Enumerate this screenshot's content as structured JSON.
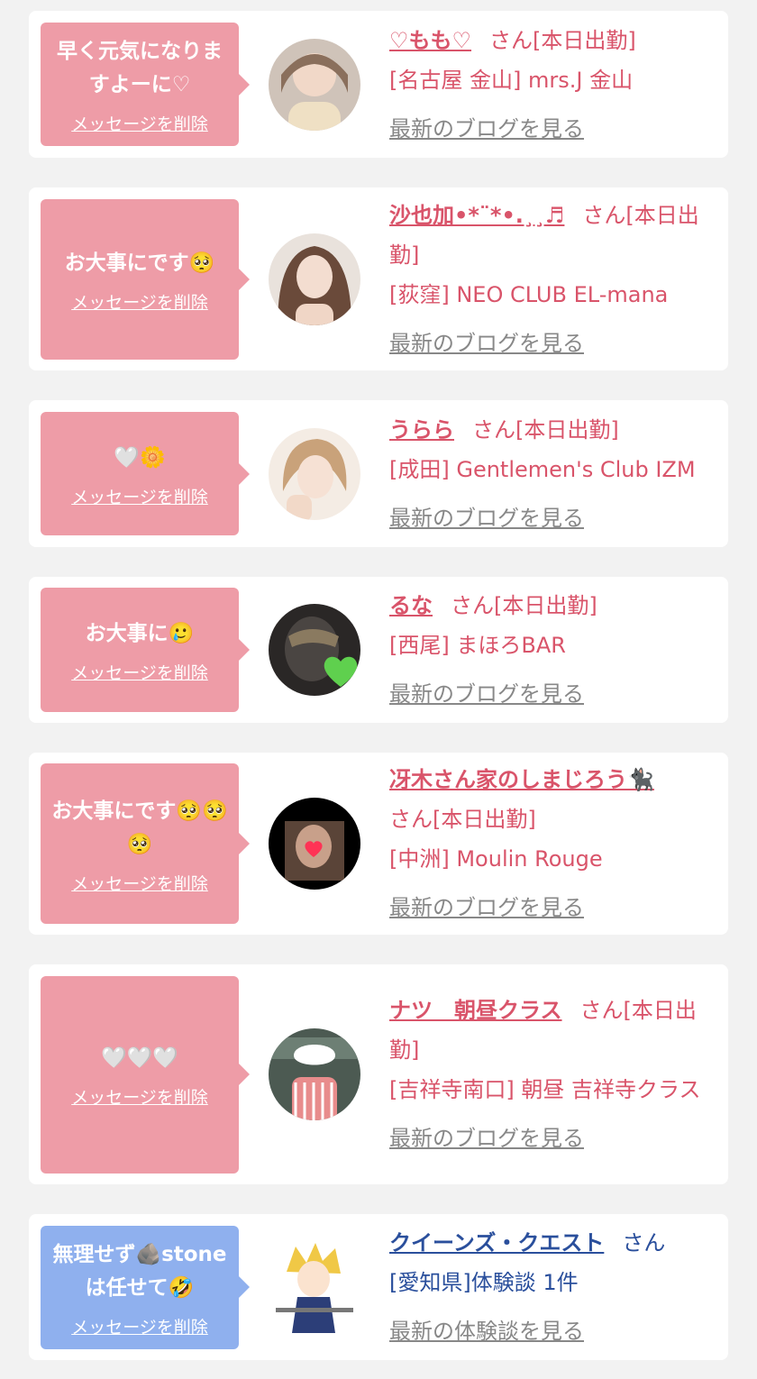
{
  "cards": [
    {
      "message": "早く元気になりますよーに♡",
      "delete_label": "メッセージを削除",
      "name": "♡もも♡",
      "suffix": "さん[本日出勤]",
      "store": "[名古屋 金山] mrs.J 金山",
      "blog_link": "最新のブログを見る",
      "avatar_icon": "profile-photo"
    },
    {
      "message": "お大事にです🥺",
      "delete_label": "メッセージを削除",
      "name": "沙也加•*¨*•.¸¸♬",
      "suffix": "さん[本日出勤]",
      "store": "[荻窪] NEO CLUB EL-mana",
      "blog_link": "最新のブログを見る",
      "avatar_icon": "profile-photo"
    },
    {
      "message": "🤍🌼",
      "delete_label": "メッセージを削除",
      "name": "うらら",
      "suffix": "さん[本日出勤]",
      "store": "[成田] Gentlemen's Club IZM",
      "blog_link": "最新のブログを見る",
      "avatar_icon": "profile-photo"
    },
    {
      "message": "お大事に🥲",
      "delete_label": "メッセージを削除",
      "name": "るな",
      "suffix": "さん[本日出勤]",
      "store": "[西尾] まほろBAR",
      "blog_link": "最新のブログを見る",
      "avatar_icon": "profile-photo"
    },
    {
      "message": "お大事にです🥺🥺🥺",
      "delete_label": "メッセージを削除",
      "name": "冴木さん家のしまじろう🐈‍⬛",
      "suffix": "さん[本日出勤]",
      "store": "[中洲] Moulin Rouge",
      "blog_link": "最新のブログを見る",
      "avatar_icon": "profile-photo"
    },
    {
      "message": "🤍🤍🤍",
      "delete_label": "メッセージを削除",
      "name": "ナツ　朝昼クラス",
      "suffix": "さん[本日出勤]",
      "store": "[吉祥寺南口] 朝昼 吉祥寺クラス",
      "blog_link": "最新のブログを見る",
      "avatar_icon": "profile-photo"
    },
    {
      "message": "無理せず🪨stoneは任せて🤣",
      "delete_label": "メッセージを削除",
      "name": "クイーンズ・クエスト",
      "suffix": "さん",
      "store": "[愛知県]体験談 1件",
      "blog_link": "最新の体験談を見る",
      "avatar_icon": "anime-character-avatar"
    }
  ],
  "colors": {
    "bubble_pink": "#ee9ca7",
    "bubble_blue": "#8fb0ee",
    "name_pink": "#d9546a",
    "name_blue": "#2a4f9c",
    "link_gray": "#888888"
  }
}
